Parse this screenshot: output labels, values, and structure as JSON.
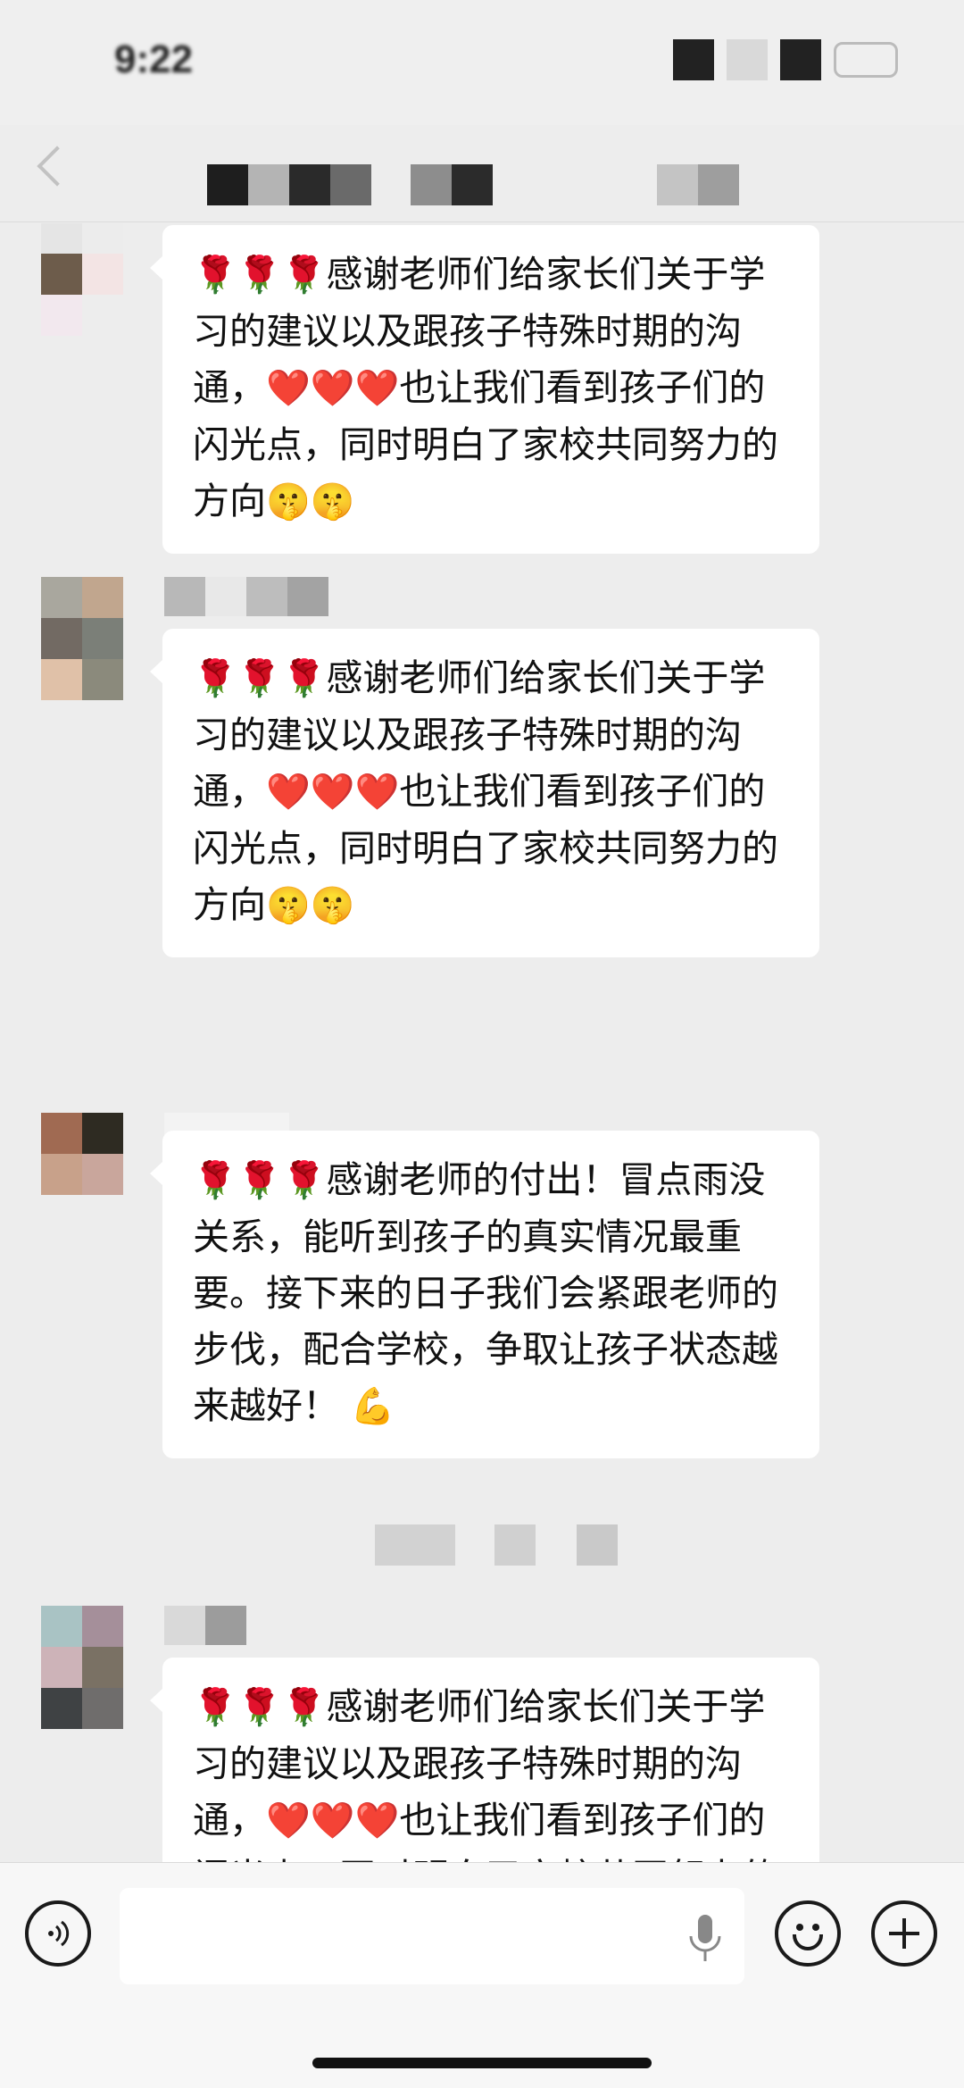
{
  "status_bar": {
    "time": "9:22"
  },
  "messages": [
    {
      "prefix": "🌹🌹🌹",
      "text": "感谢老师们给家长们关于学习的建议以及跟孩子特殊时期的沟通，",
      "hearts": "❤️❤️❤️",
      "text2": "也让我们看到孩子们的闪光点，同时明白了家校共同努力的方向",
      "suffix": "🤫🤫"
    },
    {
      "prefix": "🌹🌹🌹",
      "text": "感谢老师们给家长们关于学习的建议以及跟孩子特殊时期的沟通，",
      "hearts": "❤️❤️❤️",
      "text2": "也让我们看到孩子们的闪光点，同时明白了家校共同努力的方向",
      "suffix": "🤫🤫"
    },
    {
      "prefix": "🌹🌹🌹",
      "text": "感谢老师的付出！冒点雨没关系，能听到孩子的真实情况最重要。接下来的日子我们会紧跟老师的步伐，配合学校，争取让孩子状态越来越好！",
      "hearts": "",
      "text2": "",
      "suffix": " 💪"
    },
    {
      "prefix": "🌹🌹🌹",
      "text": "感谢老师们给家长们关于学习的建议以及跟孩子特殊时期的沟通，",
      "hearts": "❤️❤️❤️",
      "text2": "也让我们看到孩子们的闪光点，同时明白了家校共同努力的方向",
      "suffix": "🤫🤫"
    }
  ],
  "icons": {
    "voice": "voice-icon",
    "mic": "microphone-icon",
    "emoji": "emoji-icon",
    "plus": "plus-icon"
  },
  "colors": {
    "background": "#ededed",
    "bubble": "#ffffff"
  }
}
